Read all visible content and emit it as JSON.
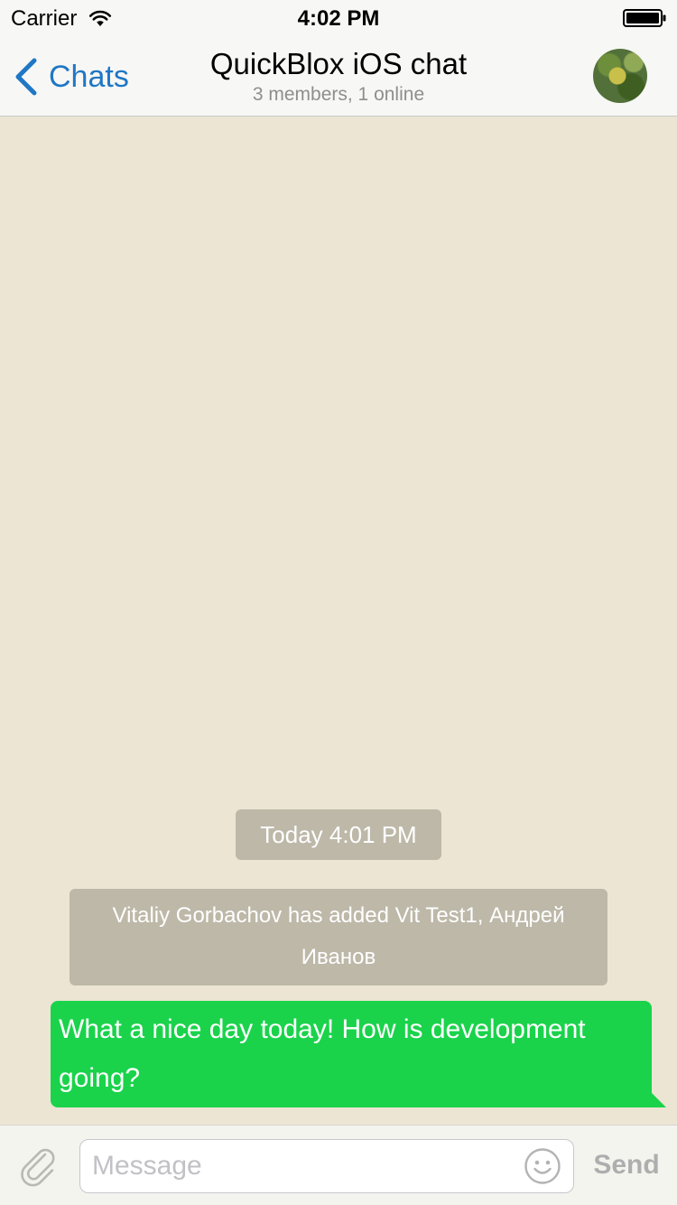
{
  "status_bar": {
    "carrier": "Carrier",
    "time": "4:02 PM"
  },
  "nav": {
    "back_label": "Chats",
    "title": "QuickBlox iOS chat",
    "subtitle": "3 members, 1 online"
  },
  "messages": {
    "date_separator": "Today 4:01 PM",
    "system_notice": "Vitaliy Gorbachov has added Vit Test1, Андрей Иванов",
    "outgoing_text": "What a nice day today! How is development going?"
  },
  "input_bar": {
    "placeholder": "Message",
    "send_label": "Send"
  },
  "colors": {
    "background": "#ece5d3",
    "accent": "#1f77c5",
    "outgoing_bubble": "#1ad34b",
    "system_bubble": "#bdb8a8"
  },
  "icons": {
    "wifi": "wifi-icon",
    "battery": "battery-icon",
    "back": "back-chevron-icon",
    "attach": "paperclip-icon",
    "emoji": "smiley-icon"
  }
}
